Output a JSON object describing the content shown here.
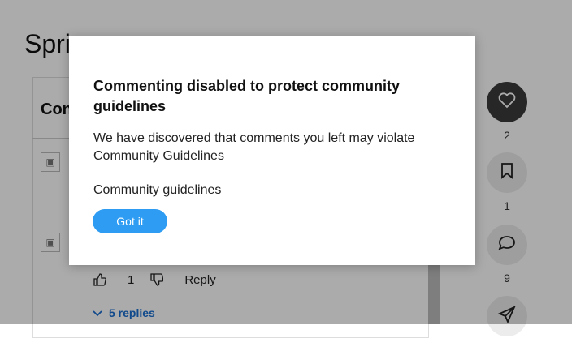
{
  "page": {
    "title_visible": "Sprin"
  },
  "comments": {
    "heading_visible": "Con",
    "like_count": "1",
    "reply_label": "Reply",
    "replies_label": "5 replies"
  },
  "sidebar": [
    {
      "icon": "heart-icon",
      "count": "2"
    },
    {
      "icon": "bookmark-icon",
      "count": "1"
    },
    {
      "icon": "comment-icon",
      "count": "9"
    },
    {
      "icon": "share-icon",
      "count": ""
    }
  ],
  "modal": {
    "title": "Commenting disabled to protect community guidelines",
    "body": "We have discovered that comments you left may violate Community Guidelines",
    "link": "Community guidelines",
    "button": "Got it"
  },
  "colors": {
    "primary": "#2d9cf2",
    "overlay": "rgba(0,0,0,0.33)"
  }
}
